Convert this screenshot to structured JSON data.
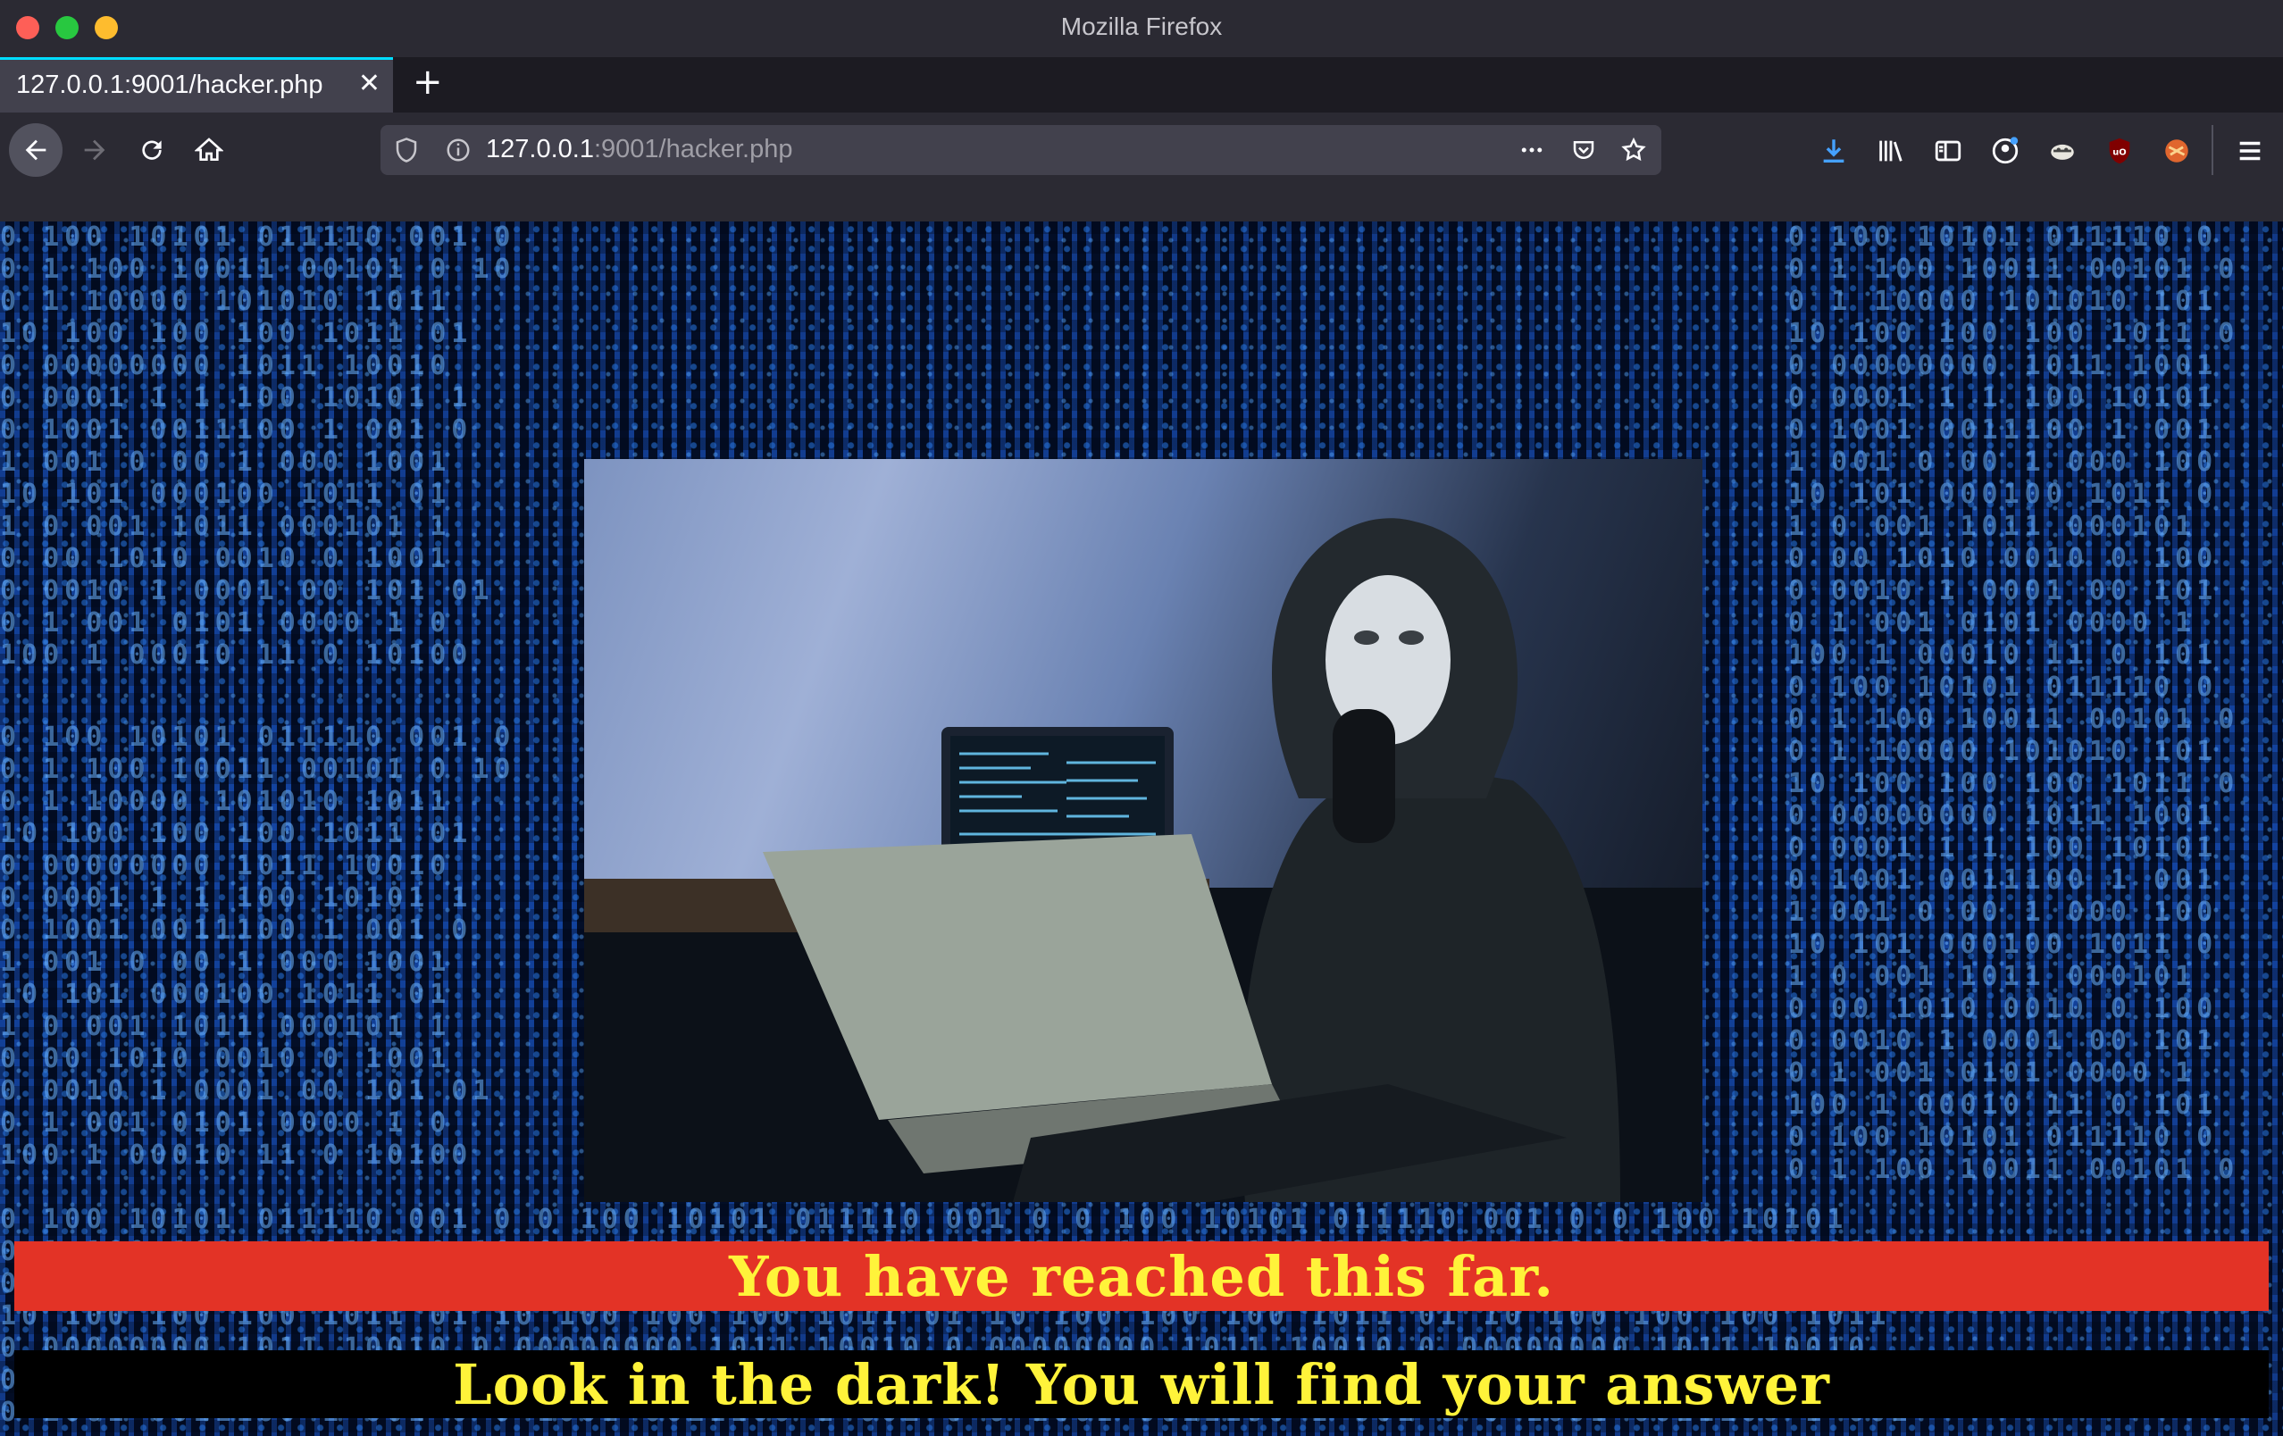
{
  "window": {
    "title": "Mozilla Firefox"
  },
  "tab": {
    "label": "127.0.0.1:9001/hacker.php"
  },
  "urlbar": {
    "host": "127.0.0.1",
    "path": ":9001/hacker.php"
  },
  "page": {
    "headline": "You have reached this far.",
    "subline": "Look in the dark! You will find your answer"
  },
  "colors": {
    "banner_red": "#e33326",
    "banner_text": "#fff33a",
    "tab_accent": "#00ddff"
  },
  "icons": [
    "back-arrow-icon",
    "forward-arrow-icon",
    "reload-icon",
    "home-icon",
    "shield-icon",
    "info-icon",
    "more-options-icon",
    "pocket-icon",
    "bookmark-star-icon",
    "download-icon",
    "library-icon",
    "sidebar-icon",
    "account-icon",
    "extension-icon",
    "ublock-icon",
    "addon-icon",
    "hamburger-menu-icon"
  ]
}
